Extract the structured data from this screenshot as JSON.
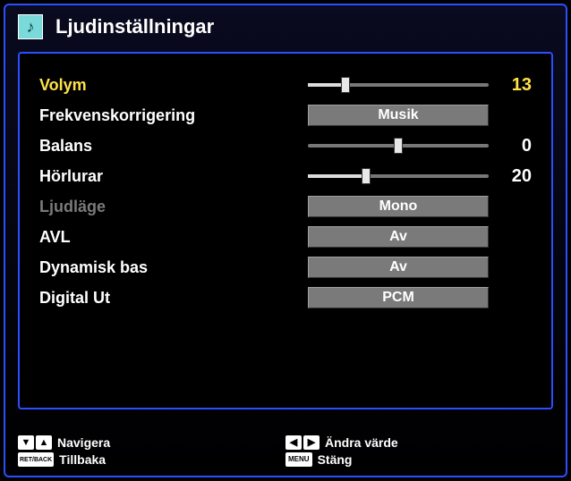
{
  "header": {
    "title": "Ljudinställningar"
  },
  "settings": {
    "volume": {
      "label": "Volym",
      "value": 13,
      "min": 0,
      "max": 63,
      "percent": 21
    },
    "eq": {
      "label": "Frekvenskorrigering",
      "value": "Musik"
    },
    "balance": {
      "label": "Balans",
      "value": 0,
      "min": -50,
      "max": 50,
      "percent": 50
    },
    "headphones": {
      "label": "Hörlurar",
      "value": 20,
      "min": 0,
      "max": 63,
      "percent": 32
    },
    "soundmode": {
      "label": "Ljudläge",
      "value": "Mono"
    },
    "avl": {
      "label": "AVL",
      "value": "Av"
    },
    "bass": {
      "label": "Dynamisk bas",
      "value": "Av"
    },
    "digital": {
      "label": "Digital Ut",
      "value": "PCM"
    }
  },
  "footer": {
    "navigate": "Navigera",
    "back_key": "RET/BACK",
    "back": "Tillbaka",
    "change": "Ändra värde",
    "close_key": "MENU",
    "close": "Stäng"
  }
}
